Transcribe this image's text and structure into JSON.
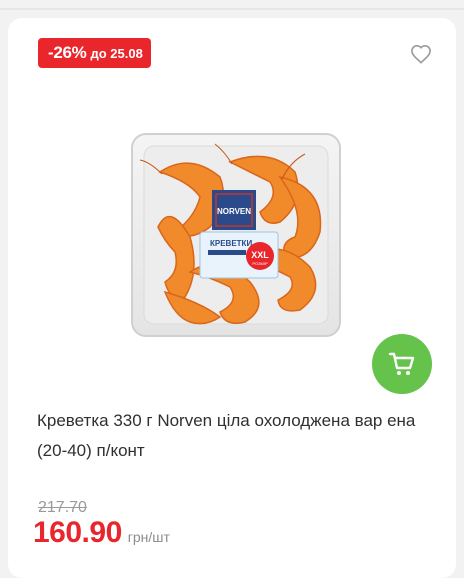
{
  "badge": {
    "discount": "-26%",
    "until": "до 25.08"
  },
  "product": {
    "title": "Креветка 330 г Norven ціла охолоджена вар ена (20-40) п/конт",
    "package_brand": "NORVEN",
    "package_name": "КРЕВЕТКИ",
    "package_size": "XXL",
    "package_size_sub": "РОЗМІР"
  },
  "price": {
    "old": "217.70",
    "current": "160.90",
    "unit": "грн/шт"
  },
  "icons": {
    "favorite": "heart-outline-icon",
    "cart": "cart-icon"
  },
  "colors": {
    "accent_red": "#e8262c",
    "cart_green": "#65c24a"
  }
}
